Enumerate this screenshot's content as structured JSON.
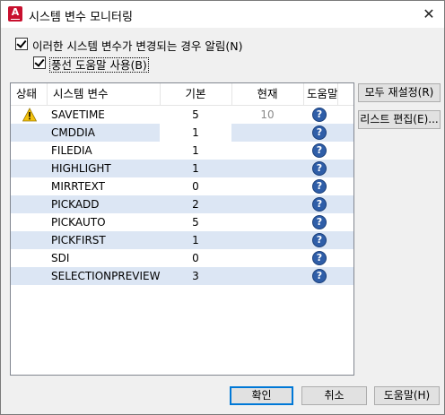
{
  "window": {
    "title": "시스템 변수 모니터링",
    "icon_letter": "A",
    "close_glyph": "✕"
  },
  "options": {
    "notify_label": "이러한 시스템 변수가 변경되는 경우 알림(N)",
    "notify_checked": true,
    "balloon_label": "풍선 도움말 사용(B)",
    "balloon_checked": true
  },
  "table": {
    "columns": [
      "상태",
      "시스템 변수",
      "기본",
      "현재",
      "도움말"
    ],
    "rows": [
      {
        "status": "warning",
        "name": "SAVETIME",
        "default": "5",
        "current": "10",
        "help": "?"
      },
      {
        "status": "",
        "name": "CMDDIA",
        "default": "1",
        "current": "",
        "help": "?"
      },
      {
        "status": "",
        "name": "FILEDIA",
        "default": "1",
        "current": "",
        "help": "?"
      },
      {
        "status": "",
        "name": "HIGHLIGHT",
        "default": "1",
        "current": "",
        "help": "?"
      },
      {
        "status": "",
        "name": "MIRRTEXT",
        "default": "0",
        "current": "",
        "help": "?"
      },
      {
        "status": "",
        "name": "PICKADD",
        "default": "2",
        "current": "",
        "help": "?"
      },
      {
        "status": "",
        "name": "PICKAUTO",
        "default": "5",
        "current": "",
        "help": "?"
      },
      {
        "status": "",
        "name": "PICKFIRST",
        "default": "1",
        "current": "",
        "help": "?"
      },
      {
        "status": "",
        "name": "SDI",
        "default": "0",
        "current": "",
        "help": "?"
      },
      {
        "status": "",
        "name": "SELECTIONPREVIEW",
        "default": "3",
        "current": "",
        "help": "?"
      }
    ]
  },
  "side_buttons": {
    "reset_all": "모두 재설정(R)",
    "edit_list": "리스트 편집(E)..."
  },
  "footer": {
    "ok": "확인",
    "cancel": "취소",
    "help": "도움말(H)"
  },
  "colors": {
    "alt_row": "#dce6f4",
    "help_icon": "#2f5ea8",
    "default_button_border": "#0078d7",
    "app_icon": "#c8102e",
    "warning_icon": "#f4c20d"
  },
  "icons": {
    "app": "autocad-logo-icon",
    "close": "close-icon",
    "warning": "warning-triangle-icon",
    "help": "help-question-icon"
  }
}
